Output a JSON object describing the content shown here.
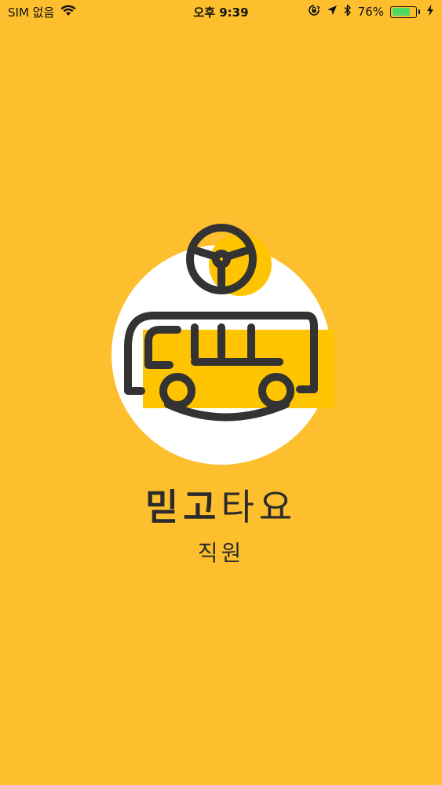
{
  "status_bar": {
    "carrier": "SIM 없음",
    "time": "오후 9:39",
    "battery_percent": "76%",
    "battery_level": 0.76
  },
  "brand": {
    "title_part1": "믿고",
    "title_part2": "타요",
    "subtitle": "직원"
  },
  "icons": {
    "wifi": "wifi-icon",
    "orientation_lock": "orientation-lock-icon",
    "location": "location-arrow-icon",
    "bluetooth": "bluetooth-icon",
    "charging": "charging-bolt-icon",
    "logo": "bus-steering-wheel-logo"
  },
  "colors": {
    "background": "#FDBF2D",
    "accent": "#FFC400",
    "circle": "#FFFFFF",
    "stroke": "#333333",
    "battery": "#4CD964"
  }
}
